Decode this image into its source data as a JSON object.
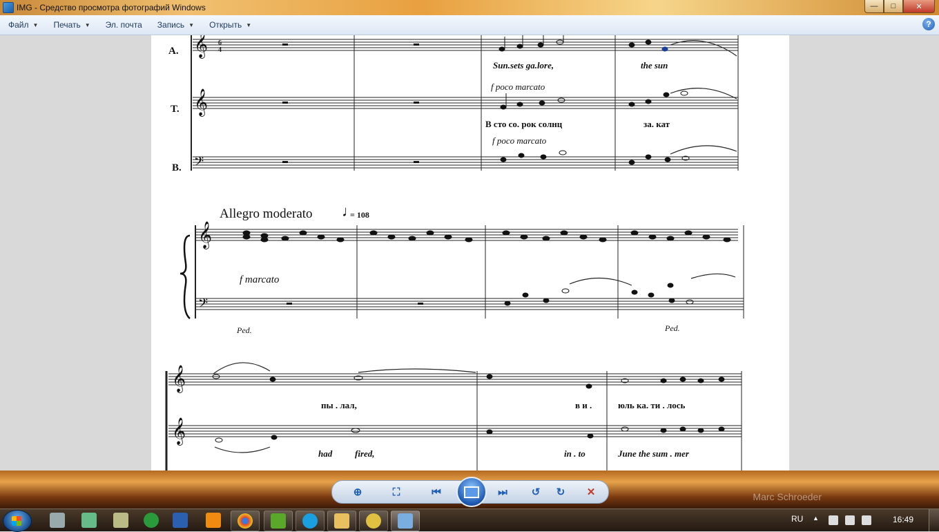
{
  "window": {
    "title": "IMG - Средство просмотра фотографий Windows",
    "minimize": "—",
    "maximize": "□",
    "close": "✕"
  },
  "menu": {
    "items": [
      {
        "label": "Файл",
        "has_dropdown": true
      },
      {
        "label": "Печать",
        "has_dropdown": true
      },
      {
        "label": "Эл. почта",
        "has_dropdown": false
      },
      {
        "label": "Запись",
        "has_dropdown": true
      },
      {
        "label": "Открыть",
        "has_dropdown": true
      }
    ],
    "help": "?"
  },
  "score": {
    "part_a": "A.",
    "part_t": "T.",
    "part_b": "B.",
    "time_sig_top": "6",
    "time_sig_bottom": "4",
    "lyric_a1": "Sun.sets ga.lore,",
    "lyric_a2": "the sun",
    "dyn_a": "f poco marcato",
    "lyric_t1": "В сто со. рок солнц",
    "lyric_t2": "за. кат",
    "dyn_t": "f poco marcato",
    "tempo": "Allegro moderato",
    "metronome": "= 108",
    "dyn_piano": "f marcato",
    "ped1": "Ped.",
    "ped2": "Ped.",
    "lyric_s2_1": "пы . лал,",
    "lyric_s2_2": "в и .",
    "lyric_s2_3": "юль   ка. ти . лось",
    "lyric_s2_4": "had",
    "lyric_s2_5": "fired,",
    "lyric_s2_6": "in . to",
    "lyric_s2_7": "June   the   sum . mer"
  },
  "controls": {
    "zoom": "zoom-icon",
    "fit": "actual-size-icon",
    "prev": "previous-icon",
    "slideshow": "slideshow-icon",
    "next": "next-icon",
    "rotate_left": "rotate-ccw-icon",
    "rotate_right": "rotate-cw-icon",
    "delete": "delete-icon"
  },
  "desktop": {
    "watermark": "Marc Schroeder"
  },
  "taskbar": {
    "lang": "RU",
    "time": "16:49"
  }
}
